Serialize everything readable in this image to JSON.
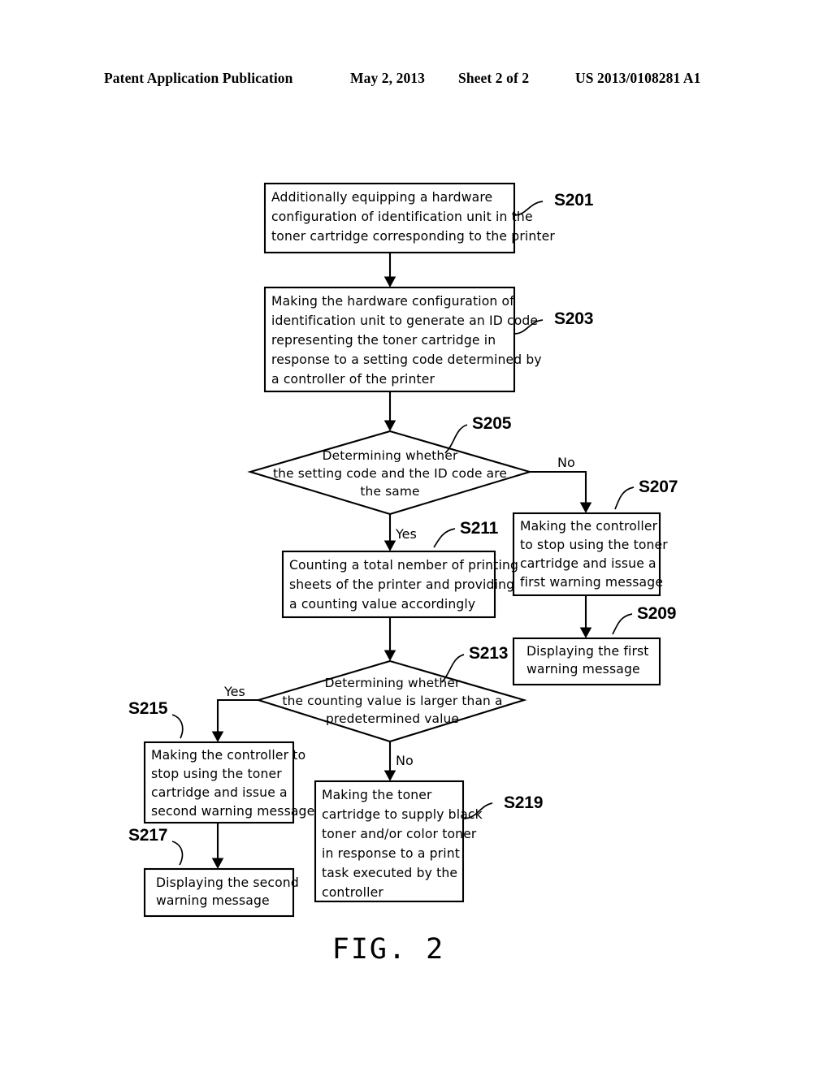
{
  "header": {
    "title": "Patent Application Publication",
    "date": "May 2, 2013",
    "sheet": "Sheet 2 of 2",
    "number": "US 2013/0108281 A1"
  },
  "figure": {
    "caption": "FIG. 2"
  },
  "chart_data": {
    "type": "diagram",
    "subtype": "flowchart",
    "title": "FIG. 2",
    "nodes": [
      {
        "id": "S201",
        "shape": "process",
        "label": "S201",
        "lines": [
          "Additionally equipping a hardware",
          "configuration of identification unit in the",
          "toner cartridge corresponding to the printer"
        ]
      },
      {
        "id": "S203",
        "shape": "process",
        "label": "S203",
        "lines": [
          "Making the hardware configuration of",
          "identification unit to generate an ID code",
          "representing the toner cartridge in",
          "response to a setting code determined by",
          "a controller of the printer"
        ]
      },
      {
        "id": "S205",
        "shape": "decision",
        "label": "S205",
        "lines": [
          "Determining whether",
          "the setting code and the ID code are",
          "the same"
        ]
      },
      {
        "id": "S207",
        "shape": "process",
        "label": "S207",
        "lines": [
          "Making the controller",
          "to stop using the toner",
          "cartridge and issue a",
          "first warning message"
        ]
      },
      {
        "id": "S209",
        "shape": "process",
        "label": "S209",
        "lines": [
          "Displaying the first",
          "warning message"
        ]
      },
      {
        "id": "S211",
        "shape": "process",
        "label": "S211",
        "lines": [
          "Counting a total nember of printing",
          "sheets of the printer and providing",
          "a counting value accordingly"
        ]
      },
      {
        "id": "S213",
        "shape": "decision",
        "label": "S213",
        "lines": [
          "Determining whether",
          "the counting value is larger than a",
          "predetermined value"
        ]
      },
      {
        "id": "S215",
        "shape": "process",
        "label": "S215",
        "lines": [
          "Making the controller to",
          "stop using the toner",
          "cartridge and issue a",
          "second warning message"
        ]
      },
      {
        "id": "S217",
        "shape": "process",
        "label": "S217",
        "lines": [
          "Displaying the second",
          "warning message"
        ]
      },
      {
        "id": "S219",
        "shape": "process",
        "label": "S219",
        "lines": [
          "Making the toner",
          "cartridge to supply black",
          "toner and/or color toner",
          "in response to a print",
          "task executed by the",
          "controller"
        ]
      }
    ],
    "edges": [
      {
        "from": "S201",
        "to": "S203",
        "label": ""
      },
      {
        "from": "S203",
        "to": "S205",
        "label": ""
      },
      {
        "from": "S205",
        "to": "S207",
        "label": "No"
      },
      {
        "from": "S205",
        "to": "S211",
        "label": "Yes"
      },
      {
        "from": "S207",
        "to": "S209",
        "label": ""
      },
      {
        "from": "S211",
        "to": "S213",
        "label": ""
      },
      {
        "from": "S213",
        "to": "S215",
        "label": "Yes"
      },
      {
        "from": "S213",
        "to": "S219",
        "label": "No"
      },
      {
        "from": "S215",
        "to": "S217",
        "label": ""
      }
    ],
    "branch_labels": {
      "s205_no": "No",
      "s205_yes": "Yes",
      "s213_yes": "Yes",
      "s213_no": "No"
    }
  }
}
